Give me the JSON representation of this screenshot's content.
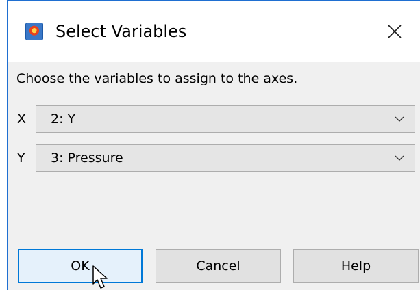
{
  "window": {
    "title": "Select Variables",
    "icon": "app-logo-icon",
    "close_icon": "close-icon"
  },
  "dialog": {
    "prompt": "Choose the variables to assign to the axes."
  },
  "axes": [
    {
      "label": "X",
      "selected": "2: Y"
    },
    {
      "label": "Y",
      "selected": "3: Pressure"
    }
  ],
  "buttons": {
    "ok": "OK",
    "cancel": "Cancel",
    "help": "Help"
  },
  "colors": {
    "window_border": "#1f6fd1",
    "client_background": "#f0f0f0",
    "default_button_border": "#0078d7",
    "default_button_fill": "#e5f1fb"
  }
}
